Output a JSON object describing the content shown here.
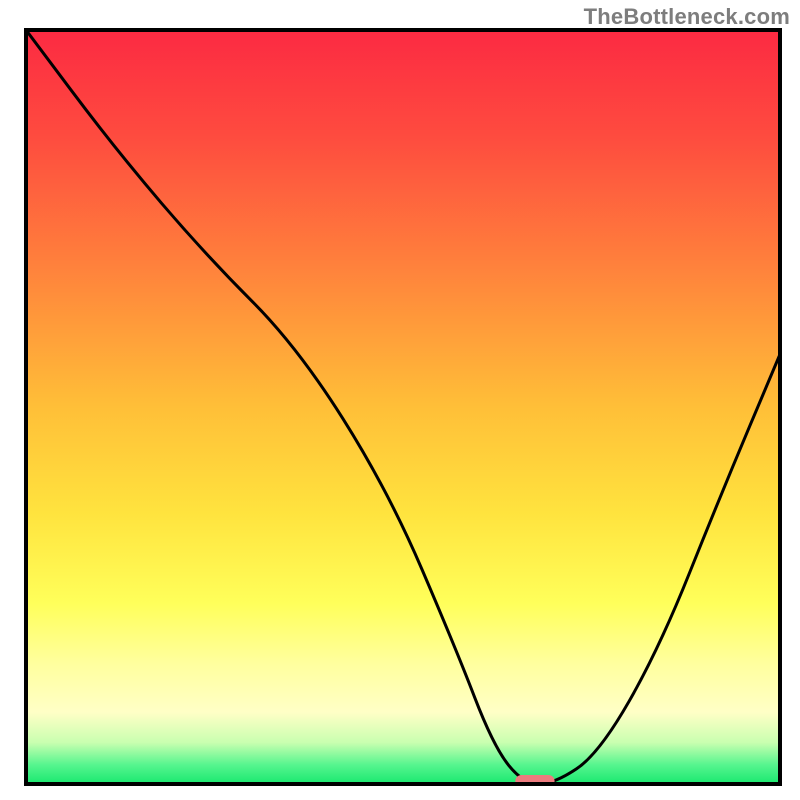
{
  "watermark": "TheBottleneck.com",
  "colors": {
    "frame_stroke": "#000000",
    "curve_stroke": "#000000",
    "marker_fill": "#ed7b7e",
    "gradient_top": "#fc2a42",
    "gradient_mid": "#ffd43a",
    "gradient_yellow_pale": "#ffff9e",
    "gradient_green": "#19e86f"
  },
  "chart_data": {
    "type": "line",
    "title": "",
    "xlabel": "",
    "ylabel": "",
    "xlim": [
      0,
      100
    ],
    "ylim": [
      0,
      100
    ],
    "x": [
      0,
      12,
      24,
      36,
      48,
      57,
      62,
      66,
      70,
      76,
      84,
      92,
      100
    ],
    "y": [
      100,
      84,
      70,
      58,
      39,
      18,
      5,
      0,
      0,
      4,
      18,
      38,
      57
    ],
    "optimum_marker": {
      "x_center": 67.5,
      "x_half_width": 2.6,
      "y": 0.4
    },
    "gradient_stops": [
      {
        "pos": 0.0,
        "hex": "#fc2a42"
      },
      {
        "pos": 0.14,
        "hex": "#fe4b3f"
      },
      {
        "pos": 0.3,
        "hex": "#ff7d3c"
      },
      {
        "pos": 0.5,
        "hex": "#ffbf38"
      },
      {
        "pos": 0.64,
        "hex": "#ffe33e"
      },
      {
        "pos": 0.76,
        "hex": "#ffff5a"
      },
      {
        "pos": 0.84,
        "hex": "#ffff9e"
      },
      {
        "pos": 0.905,
        "hex": "#ffffc6"
      },
      {
        "pos": 0.945,
        "hex": "#c9ffb0"
      },
      {
        "pos": 0.975,
        "hex": "#55f58e"
      },
      {
        "pos": 1.0,
        "hex": "#19e86f"
      }
    ],
    "description": "V-shaped bottleneck curve. x-axis is an implicit configuration sweep (0–100). y-axis is bottleneck percentage (0–100). Curve starts at 100% at x=0, descends roughly linearly with a slight knee around x≈24, reaches 0% near x≈66–70, then rises again to ≈57% at x=100. Background is a vertical red→yellow→green gradient representing bad→good. A small pink pill marker sits at the valley floor."
  }
}
